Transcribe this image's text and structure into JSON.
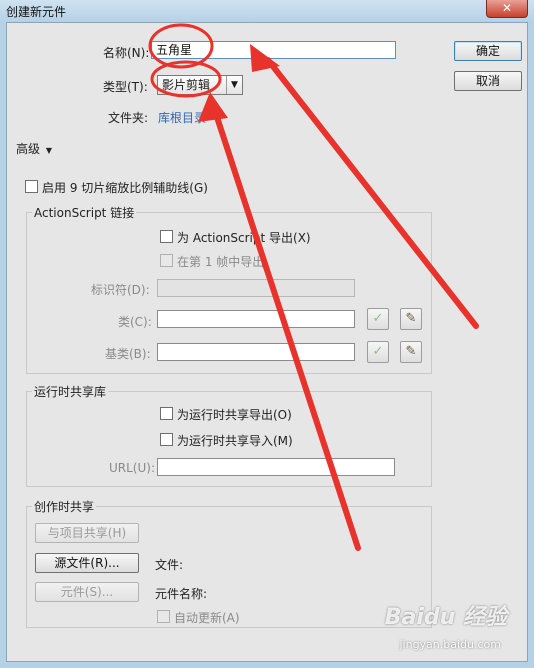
{
  "window": {
    "title": "创建新元件",
    "close_glyph": "✕"
  },
  "form": {
    "name_label": "名称(N):",
    "name_value": "五角星",
    "type_label": "类型(T):",
    "type_value": "影片剪辑",
    "folder_label": "文件夹:",
    "folder_value": "库根目录",
    "advanced_label": "高级",
    "advanced_arrow": "▼",
    "nine_slice_label": "启用 9 切片缩放比例辅助线(G)"
  },
  "buttons": {
    "ok": "确定",
    "cancel": "取消"
  },
  "actionscript": {
    "group_title": "ActionScript 链接",
    "export_label": "为 ActionScript 导出(X)",
    "export_frame1_label": "在第 1 帧中导出",
    "identifier_label": "标识符(D):",
    "class_label": "类(C):",
    "base_class_label": "基类(B):",
    "check_glyph": "✓",
    "edit_glyph": "✎"
  },
  "runtime_shared": {
    "group_title": "运行时共享库",
    "export_label": "为运行时共享导出(O)",
    "import_label": "为运行时共享导入(M)",
    "url_label": "URL(U):"
  },
  "authortime_shared": {
    "group_title": "创作时共享",
    "share_with_project_button": "与项目共享(H)",
    "source_file_button": "源文件(R)...",
    "file_label": "文件:",
    "symbol_button": "元件(S)...",
    "symbol_name_label": "元件名称:",
    "auto_update_label": "自动更新(A)"
  },
  "watermark": {
    "logo": "Baidu 经验",
    "url": "jingyan.baidu.com"
  },
  "colors": {
    "annotation": "#e8322c",
    "link": "#2b67b8"
  }
}
